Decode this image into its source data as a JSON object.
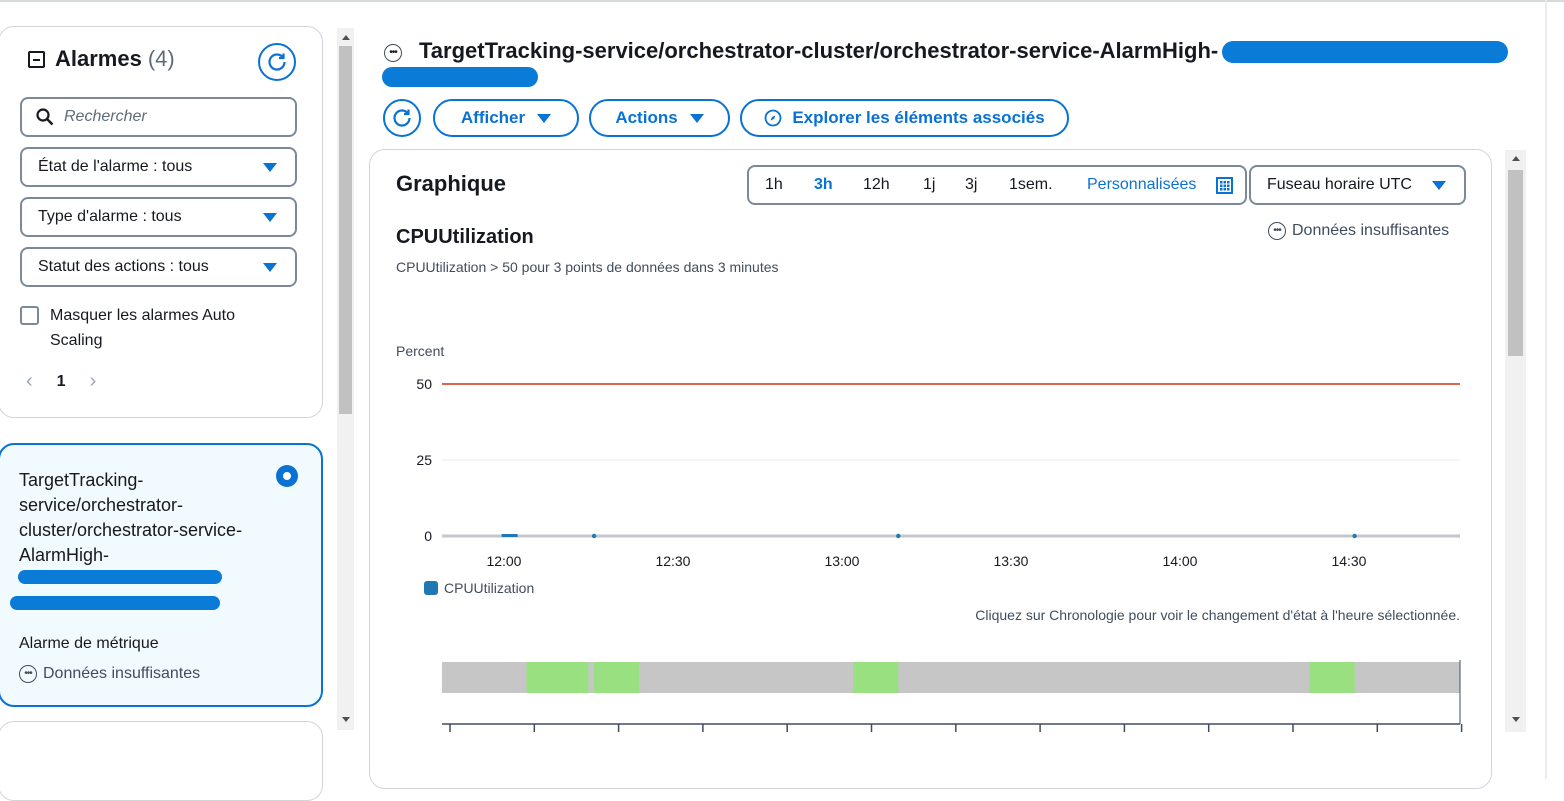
{
  "left_panel": {
    "title": "Alarmes",
    "count": "(4)",
    "search_placeholder": "Rechercher",
    "filters": [
      {
        "label": "État de l'alarme : tous"
      },
      {
        "label": "Type d'alarme : tous"
      },
      {
        "label": "Statut des actions : tous"
      }
    ],
    "hide_autoscaling_label": "Masquer les alarmes Auto Scaling",
    "page_number": "1",
    "selected_alarm": {
      "name": "TargetTracking-service/orchestrator-cluster/orchestrator-service-AlarmHigh-",
      "type": "Alarme de métrique",
      "status": "Données insuffisantes"
    }
  },
  "header": {
    "title": "TargetTracking-service/orchestrator-cluster/orchestrator-service-AlarmHigh-",
    "buttons": {
      "afficher": "Afficher",
      "actions": "Actions",
      "explorer": "Explorer les éléments associés"
    }
  },
  "graph": {
    "title": "Graphique",
    "time_ranges": [
      "1h",
      "3h",
      "12h",
      "1j",
      "3j",
      "1sem."
    ],
    "selected_range": "3h",
    "custom_label": "Personnalisées",
    "timezone": "Fuseau horaire UTC",
    "metric_title": "CPUUtilization",
    "metric_subtitle": "CPUUtilization > 50 pour 3 points de données dans 3 minutes",
    "state": "Données insuffisantes",
    "timeline_hint": "Cliquez sur Chronologie pour voir le changement d'état à l'heure sélectionnée."
  },
  "chart_data": {
    "type": "line",
    "ylabel": "Percent",
    "ylim": [
      0,
      50
    ],
    "y_ticks": [
      "50",
      "25",
      "0"
    ],
    "x_ticks": [
      "12:00",
      "12:30",
      "13:00",
      "13:30",
      "14:00",
      "14:30"
    ],
    "threshold": 50,
    "threshold_color": "#d13212",
    "series": [
      {
        "name": "CPUUtilization",
        "color": "#1f77b4",
        "points": [
          {
            "x": "12:01",
            "y": 0
          },
          {
            "x": "12:16",
            "y": 0
          },
          {
            "x": "13:10",
            "y": 0
          },
          {
            "x": "14:31",
            "y": 0
          }
        ]
      }
    ],
    "x_range_minutes_from": "11:49",
    "grid": true
  },
  "timeline": {
    "ok_color": "#98e080",
    "insufficient_color": "#c6c6c6",
    "ok_periods": [
      [
        "12:04",
        "12:15"
      ],
      [
        "12:16",
        "12:24"
      ],
      [
        "13:02",
        "13:10"
      ],
      [
        "14:23",
        "14:31"
      ]
    ]
  },
  "colors": {
    "accent": "#0972d3",
    "text": "#16191f",
    "muted": "#414d5c"
  }
}
